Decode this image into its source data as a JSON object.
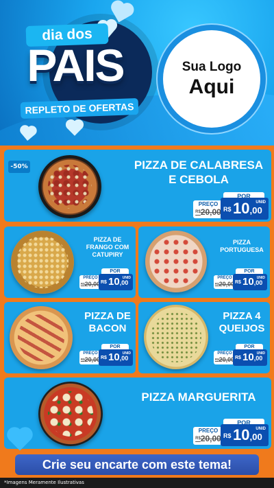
{
  "header": {
    "title_top": "dia dos",
    "title_main": "PAIS",
    "subtitle": "REPLETO DE OFERTAS",
    "logo_line1": "Sua Logo",
    "logo_line2": "Aqui"
  },
  "products": [
    {
      "name": "PIZZA DE CALABRESA E CEBOLA",
      "badge": "-50%",
      "por": "POR",
      "preco_label": "PREÇO",
      "old_prefix": "R$",
      "old_price": "20,00",
      "currency": "R$",
      "price_int": "10",
      "price_dec": ",00",
      "unit": "UNID"
    },
    {
      "name": "PIZZA DE FRANGO COM CATUPIRY",
      "por": "POR",
      "preco_label": "PREÇO",
      "old_prefix": "R$",
      "old_price": "20,00",
      "currency": "R$",
      "price_int": "10",
      "price_dec": ",00",
      "unit": "UNID"
    },
    {
      "name": "PIZZA PORTUGUESA",
      "por": "POR",
      "preco_label": "PREÇO",
      "old_prefix": "R$",
      "old_price": "20,00",
      "currency": "R$",
      "price_int": "10",
      "price_dec": ",00",
      "unit": "UNID"
    },
    {
      "name": "PIZZA DE BACON",
      "por": "POR",
      "preco_label": "PREÇO",
      "old_prefix": "R$",
      "old_price": "20,00",
      "currency": "R$",
      "price_int": "10",
      "price_dec": ",00",
      "unit": "UNID"
    },
    {
      "name": "PIZZA 4 QUEIJOS",
      "por": "POR",
      "preco_label": "PREÇO",
      "old_prefix": "R$",
      "old_price": "20,00",
      "currency": "R$",
      "price_int": "10",
      "price_dec": ",00",
      "unit": "UNID"
    },
    {
      "name": "PIZZA MARGUERITA",
      "por": "POR",
      "preco_label": "PREÇO",
      "old_prefix": "R$",
      "old_price": "20,00",
      "currency": "R$",
      "price_int": "10",
      "price_dec": ",00",
      "unit": "UNID"
    }
  ],
  "cta": "Crie seu encarte com este tema!",
  "footer_note": "*Imagens Meramente Ilustrativas",
  "colors": {
    "header_blue": "#1aa6ef",
    "card_blue": "#1aa3e8",
    "background_orange": "#f07a1c",
    "price_blue": "#0b4fb0"
  }
}
